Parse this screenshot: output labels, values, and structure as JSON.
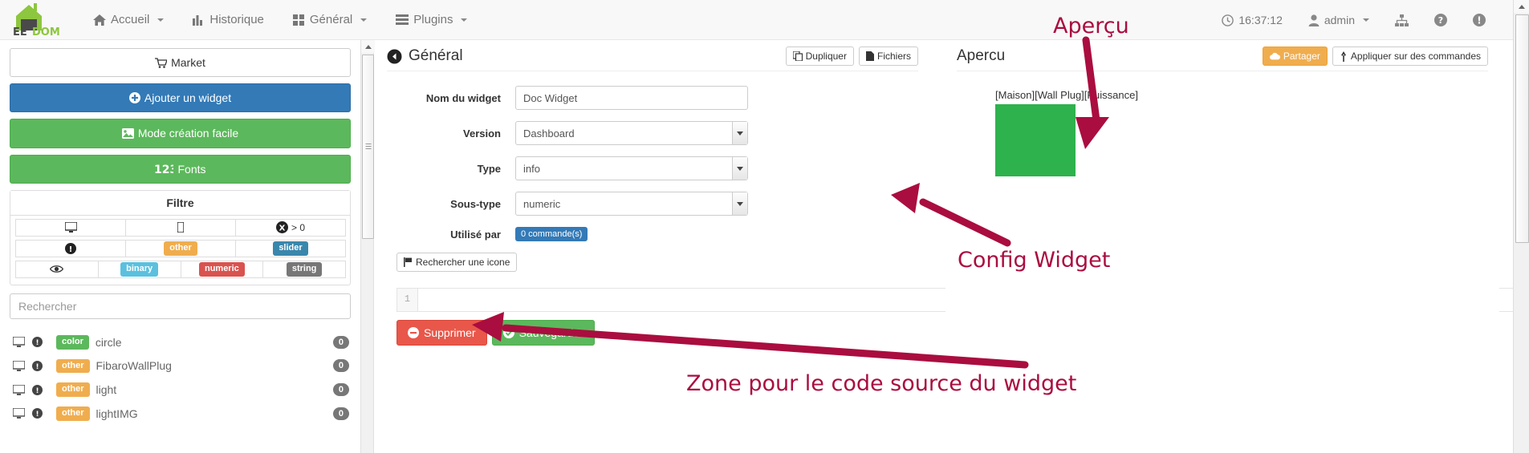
{
  "navbar": {
    "brand": "EEDOM",
    "items": [
      {
        "label": "Accueil",
        "icon": "home-icon",
        "caret": true
      },
      {
        "label": "Historique",
        "icon": "chart-bar-icon",
        "caret": false
      },
      {
        "label": "Général",
        "icon": "th-large-icon",
        "caret": true
      },
      {
        "label": "Plugins",
        "icon": "list-icon",
        "caret": true
      }
    ],
    "right": {
      "clock_icon": "clock-icon",
      "time": "16:37:12",
      "user_icon": "user-icon",
      "user": "admin",
      "network_icon": "sitemap-icon",
      "help_icon": "question-circle-icon",
      "alert_icon": "exclamation-circle-icon"
    }
  },
  "sidebar": {
    "market_label": "Market",
    "market_icon": "shopping-cart-icon",
    "add_widget_label": "Ajouter un widget",
    "add_widget_icon": "plus-circle-icon",
    "easy_mode_label": "Mode création facile",
    "easy_mode_icon": "image-icon",
    "fonts_label": "Fonts",
    "fonts_icon": "fonts-123-icon",
    "filter_title": "Filtre",
    "filter_rows": [
      [
        {
          "type": "icon",
          "icon": "desktop-icon",
          "label": ""
        },
        {
          "type": "icon",
          "icon": "mobile-icon",
          "label": ""
        },
        {
          "type": "icon-text",
          "icon": "x-circle-icon",
          "label": "> 0"
        }
      ],
      [
        {
          "type": "icon",
          "icon": "exclamation-circle-icon",
          "label": ""
        },
        {
          "type": "tag",
          "label": "other",
          "color": "#f0ad4e"
        },
        {
          "type": "tag",
          "label": "slider",
          "color": "#3a87ad"
        }
      ],
      [
        {
          "type": "icon",
          "icon": "eye-icon",
          "label": ""
        },
        {
          "type": "tag",
          "label": "binary",
          "color": "#5bc0de"
        },
        {
          "type": "tag",
          "label": "numeric",
          "color": "#d9534f"
        },
        {
          "type": "tag",
          "label": "string",
          "color": "#777777"
        }
      ]
    ],
    "search_placeholder": "Rechercher",
    "search_value": "",
    "widgets": [
      {
        "device_icon": "desktop-icon",
        "info_icon": "exclamation-circle-icon",
        "tag": "color",
        "tag_color": "#5cb85c",
        "name": "circle",
        "count": "0"
      },
      {
        "device_icon": "desktop-icon",
        "info_icon": "exclamation-circle-icon",
        "tag": "other",
        "tag_color": "#f0ad4e",
        "name": "FibaroWallPlug",
        "count": "0"
      },
      {
        "device_icon": "desktop-icon",
        "info_icon": "exclamation-circle-icon",
        "tag": "other",
        "tag_color": "#f0ad4e",
        "name": "light",
        "count": "0"
      },
      {
        "device_icon": "desktop-icon",
        "info_icon": "exclamation-circle-icon",
        "tag": "other",
        "tag_color": "#f0ad4e",
        "name": "lightIMG",
        "count": "0"
      }
    ]
  },
  "center": {
    "back_icon": "arrow-circle-left-icon",
    "title": "Général",
    "duplicate_label": "Dupliquer",
    "duplicate_icon": "copy-icon",
    "files_label": "Fichiers",
    "files_icon": "file-icon",
    "fields": {
      "name_label": "Nom du widget",
      "name_value": "Doc Widget",
      "version_label": "Version",
      "version_value": "Dashboard",
      "type_label": "Type",
      "type_value": "info",
      "subtype_label": "Sous-type",
      "subtype_value": "numeric",
      "usedby_label": "Utilisé par",
      "usedby_badge": "0 commande(s)"
    },
    "icon_search_label": "Rechercher une icone",
    "icon_search_icon": "flag-icon",
    "code_line_number": "1",
    "code_value": "",
    "delete_label": "Supprimer",
    "delete_icon": "minus-circle-icon",
    "save_label": "Sauvegarder",
    "save_icon": "check-circle-icon"
  },
  "right": {
    "title": "Apercu",
    "share_label": "Partager",
    "share_icon": "cloud-icon",
    "apply_label": "Appliquer sur des commandes",
    "apply_icon": "magnet-icon",
    "preview_command_label": "[Maison][Wall Plug][Puissance]",
    "preview_color": "#2eb24d"
  },
  "annotations": {
    "color": "#aa0d3f",
    "items": [
      {
        "text": "Aperçu"
      },
      {
        "text": "Config Widget"
      },
      {
        "text": "Zone pour le code source du widget"
      }
    ]
  }
}
